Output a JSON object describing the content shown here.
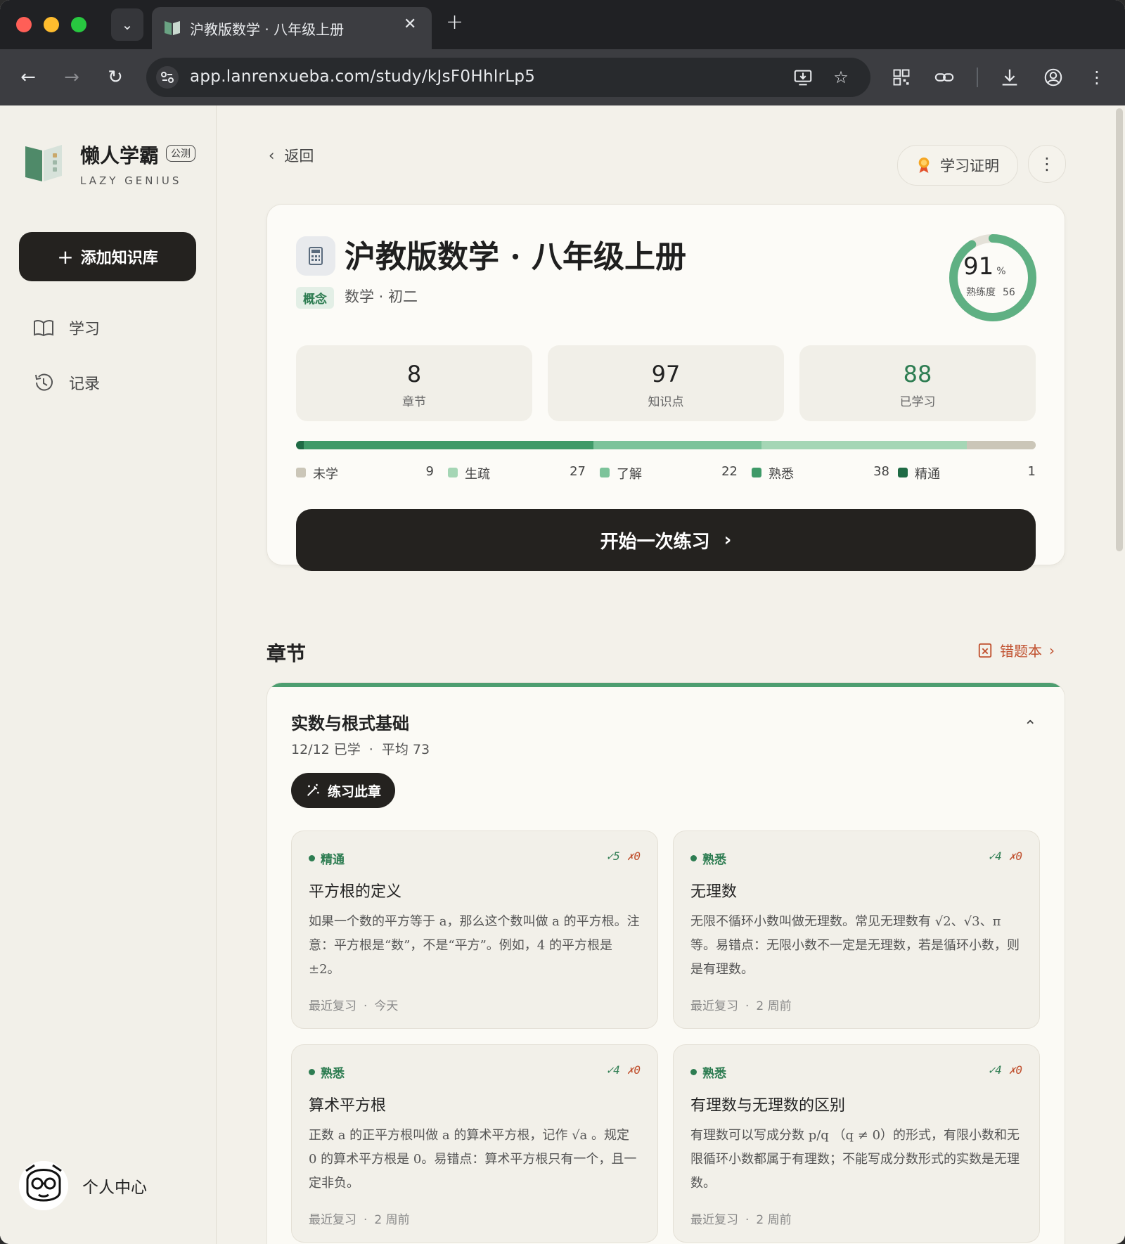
{
  "browser": {
    "tab_title": "沪教版数学 · 八年级上册",
    "url": "app.lanrenxueba.com/study/kJsF0HhlrLp5"
  },
  "sidebar": {
    "brand": "懒人学霸",
    "beta_badge": "公测",
    "brand_sub": "LAZY GENIUS",
    "add_button": "添加知识库",
    "items": [
      {
        "label": "学习",
        "icon": "book-icon"
      },
      {
        "label": "记录",
        "icon": "history-icon"
      }
    ],
    "profile_label": "个人中心"
  },
  "header": {
    "back_label": "返回",
    "certificate_label": "学习证明"
  },
  "course": {
    "title": "沪教版数学 · 八年级上册",
    "tag": "概念",
    "subject": "数学 · 初二",
    "mastery_percent": 91,
    "percent_sign": "%",
    "mastery_label": "熟练度",
    "mastery_score": "56",
    "stats": [
      {
        "value": "8",
        "label": "章节"
      },
      {
        "value": "97",
        "label": "知识点"
      },
      {
        "value": "88",
        "label": "已学习"
      }
    ],
    "levels": [
      {
        "label": "未学",
        "count": 9,
        "color": "#cbc6b8"
      },
      {
        "label": "生疏",
        "count": 27,
        "color": "#a5d6b5"
      },
      {
        "label": "了解",
        "count": 22,
        "color": "#7cc39a"
      },
      {
        "label": "熟悉",
        "count": 38,
        "color": "#3f9a68"
      },
      {
        "label": "精通",
        "count": 1,
        "color": "#1f6b45"
      }
    ],
    "start_button": "开始一次练习"
  },
  "chapters_section": {
    "title": "章节",
    "wrong_book_label": "错题本"
  },
  "chapter": {
    "title": "实数与根式基础",
    "progress": "12/12 已学",
    "average": "平均 73",
    "practice_button": "练习此章",
    "points": [
      {
        "status": "精通",
        "correct": "✓5",
        "wrong": "✗0",
        "title": "平方根的定义",
        "desc": "如果一个数的平方等于 a，那么这个数叫做 a 的平方根。注意：平方根是“数”，不是“平方”。例如，4 的平方根是 ±2。",
        "review_label": "最近复习",
        "review_time": "今天"
      },
      {
        "status": "熟悉",
        "correct": "✓4",
        "wrong": "✗0",
        "title": "无理数",
        "desc": "无限不循环小数叫做无理数。常见无理数有 √2、√3、π 等。易错点：无限小数不一定是无理数，若是循环小数，则是有理数。",
        "review_label": "最近复习",
        "review_time": "2 周前"
      },
      {
        "status": "熟悉",
        "correct": "✓4",
        "wrong": "✗0",
        "title": "算术平方根",
        "desc": "正数 a 的正平方根叫做 a 的算术平方根，记作 √a 。规定 0 的算术平方根是 0。易错点：算术平方根只有一个，且一定非负。",
        "review_label": "最近复习",
        "review_time": "2 周前"
      },
      {
        "status": "熟悉",
        "correct": "✓4",
        "wrong": "✗0",
        "title": "有理数与无理数的区别",
        "desc": "有理数可以写成分数 p/q （q ≠ 0）的形式，有限小数和无限循环小数都属于有理数；不能写成分数形式的实数是无理数。",
        "review_label": "最近复习",
        "review_time": "2 周前"
      }
    ]
  }
}
